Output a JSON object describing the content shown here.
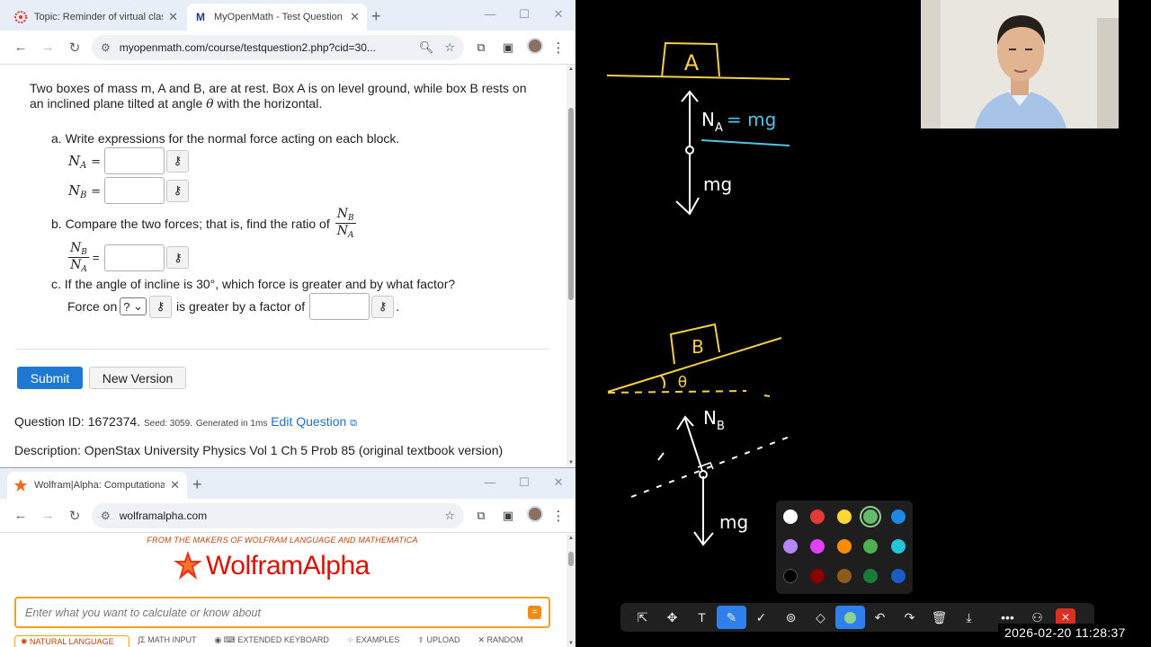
{
  "browser1": {
    "tabs": [
      {
        "title": "Topic: Reminder of virtual class",
        "active": false
      },
      {
        "title": "MyOpenMath - Test Question",
        "active": true
      }
    ],
    "url": "myopenmath.com/course/testquestion2.php?cid=30..."
  },
  "question": {
    "intro_1": "Two boxes of mass m, A and B, are at rest. Box A is on level ground, while box B rests on an inclined plane tilted at angle",
    "intro_theta": "θ",
    "intro_2": "with the horizontal.",
    "part_a": "a. Write expressions for the normal force acting on each block.",
    "na_symbol": "N",
    "na_sub": "A",
    "nb_symbol": "N",
    "nb_sub": "B",
    "eq": "=",
    "part_b": "b. Compare the two forces; that is, find the ratio of",
    "part_c_1": "c. If the angle of incline is 30°, which force is greater and by what factor?",
    "force_on": "Force on",
    "select_value": "?",
    "greater_by": "is greater by a factor of",
    "period": ".",
    "key_icon": "⚷"
  },
  "actions": {
    "submit": "Submit",
    "new_version": "New Version"
  },
  "meta": {
    "qid_label": "Question ID: 1672374.",
    "seed": "Seed: 3059.",
    "generated": "Generated in 1ms",
    "edit_question": "Edit Question",
    "description": "Description: OpenStax University Physics Vol 1 Ch 5 Prob 85 (original textbook version)"
  },
  "browser2": {
    "tab_title": "Wolfram|Alpha: Computational",
    "url": "wolframalpha.com"
  },
  "wolfram": {
    "makers": "FROM THE MAKERS OF WOLFRAM LANGUAGE AND MATHEMATICA",
    "logo": "WolframAlpha",
    "placeholder": "Enter what you want to calculate or know about",
    "links": [
      "NATURAL LANGUAGE",
      "MATH INPUT",
      "EXTENDED KEYBOARD",
      "EXAMPLES",
      "UPLOAD",
      "RANDOM"
    ]
  },
  "board": {
    "label_a": "A",
    "label_b": "B",
    "na_label": "N",
    "na_sub": "A",
    "na_eq": "= mg",
    "mg_a": "mg",
    "theta": "θ",
    "nb_label": "N",
    "nb_sub": "B",
    "mg_b": "mg",
    "ink_yellow": "#f5d142",
    "ink_white": "#ffffff",
    "ink_cyan": "#52c3e6",
    "palette": [
      "#ffffff",
      "#e53935",
      "#fdd835",
      "#66bb6a",
      "#1e88e5",
      "#b388ff",
      "#e040fb",
      "#fb8c00",
      "#4caf50",
      "#26c6da",
      "#000000",
      "#8b0000",
      "#8d5a1a",
      "#1b7a3a",
      "#1e5bc6"
    ],
    "timestamp": "2026-02-20 11:28:37"
  }
}
